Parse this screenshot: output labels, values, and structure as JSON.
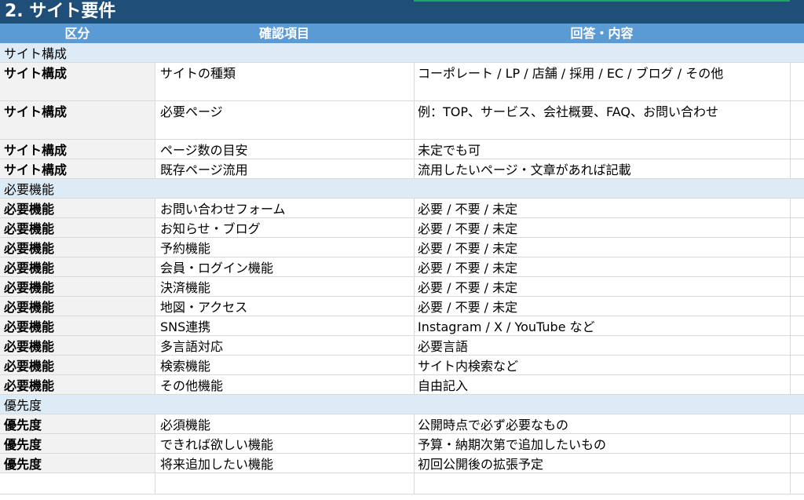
{
  "sheet": {
    "title": "2. サイト要件",
    "headers": [
      "区分",
      "確認項目",
      "回答・内容"
    ],
    "rows": [
      {
        "type": "section",
        "label": "サイト構成"
      },
      {
        "type": "data",
        "category": "サイト構成",
        "item": "サイトの種類",
        "answer": "コーポレート / LP / 店舗 / 採用 / EC / ブログ / その他"
      },
      {
        "type": "data",
        "category": "サイト構成",
        "item": "必要ページ",
        "answer": "例：TOP、サービス、会社概要、FAQ、お問い合わせ"
      },
      {
        "type": "data",
        "category": "サイト構成",
        "item": "ページ数の目安",
        "answer": "未定でも可"
      },
      {
        "type": "data",
        "category": "サイト構成",
        "item": "既存ページ流用",
        "answer": "流用したいページ・文章があれば記載"
      },
      {
        "type": "section",
        "label": "必要機能"
      },
      {
        "type": "data",
        "category": "必要機能",
        "item": "お問い合わせフォーム",
        "answer": "必要 / 不要 / 未定"
      },
      {
        "type": "data",
        "category": "必要機能",
        "item": "お知らせ・ブログ",
        "answer": "必要 / 不要 / 未定"
      },
      {
        "type": "data",
        "category": "必要機能",
        "item": "予約機能",
        "answer": "必要 / 不要 / 未定"
      },
      {
        "type": "data",
        "category": "必要機能",
        "item": "会員・ログイン機能",
        "answer": "必要 / 不要 / 未定"
      },
      {
        "type": "data",
        "category": "必要機能",
        "item": "決済機能",
        "answer": "必要 / 不要 / 未定"
      },
      {
        "type": "data",
        "category": "必要機能",
        "item": "地図・アクセス",
        "answer": "必要 / 不要 / 未定"
      },
      {
        "type": "data",
        "category": "必要機能",
        "item": "SNS連携",
        "answer": "Instagram / X / YouTube など"
      },
      {
        "type": "data",
        "category": "必要機能",
        "item": "多言語対応",
        "answer": "必要言語"
      },
      {
        "type": "data",
        "category": "必要機能",
        "item": "検索機能",
        "answer": "サイト内検索など"
      },
      {
        "type": "data",
        "category": "必要機能",
        "item": "その他機能",
        "answer": "自由記入"
      },
      {
        "type": "section",
        "label": "優先度"
      },
      {
        "type": "data",
        "category": "優先度",
        "item": "必須機能",
        "answer": "公開時点で必ず必要なもの"
      },
      {
        "type": "data",
        "category": "優先度",
        "item": "できれば欲しい機能",
        "answer": "予算・納期次第で追加したいもの"
      },
      {
        "type": "data",
        "category": "優先度",
        "item": "将来追加したい機能",
        "answer": "初回公開後の拡張予定"
      },
      {
        "type": "blank"
      }
    ]
  },
  "colors": {
    "title_bg": "#1f4e79",
    "header_bg": "#5b9bd5",
    "section_bg": "#ddebf7",
    "category_bg": "#f2f2f2",
    "gridline": "#d9d9d9",
    "selection": "#21a366"
  }
}
